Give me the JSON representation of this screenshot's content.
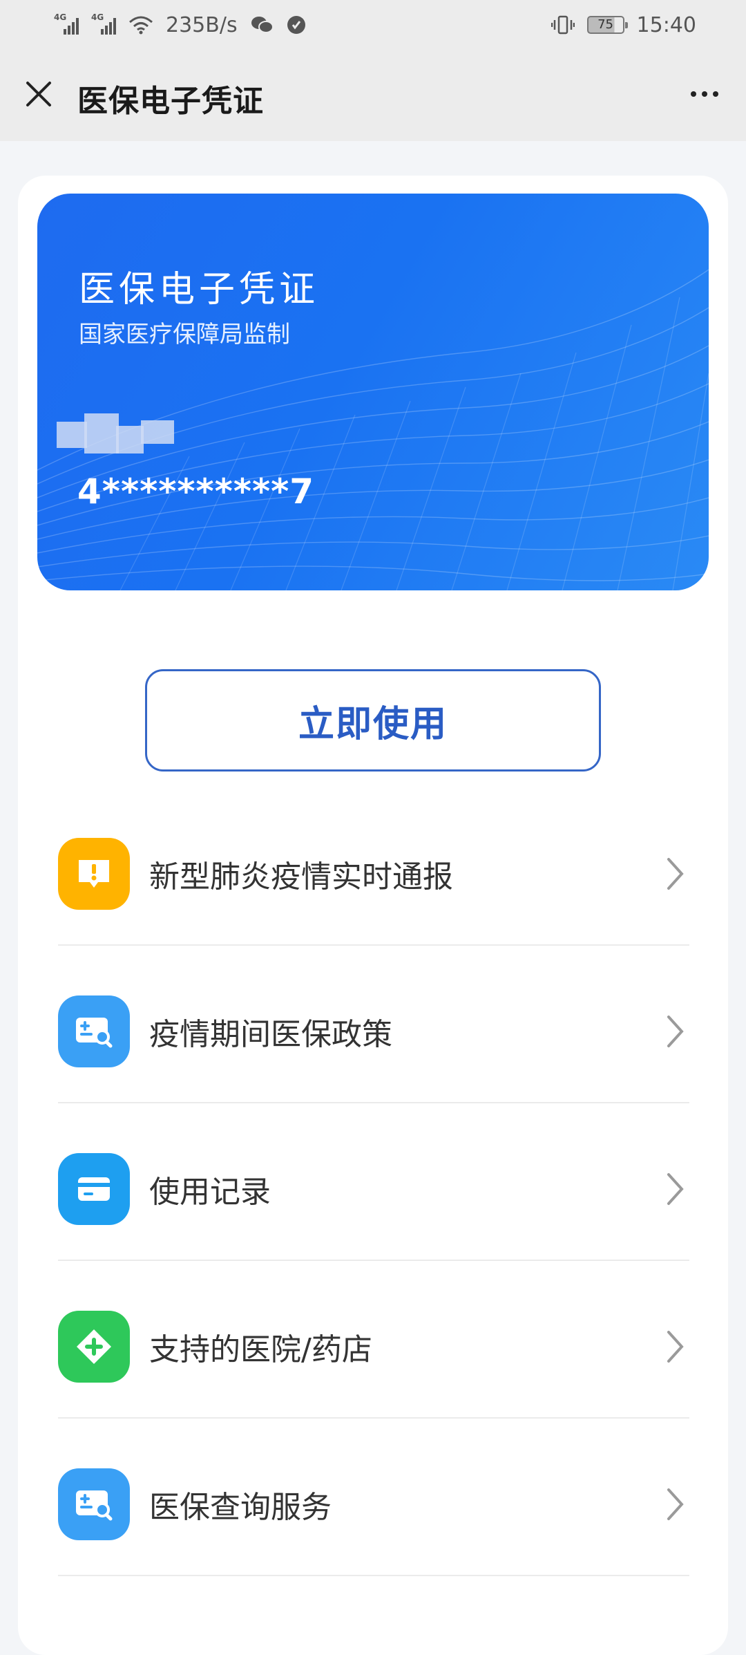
{
  "status_bar": {
    "network_1": "4G",
    "network_2": "4G",
    "speed": "235B/s",
    "battery": "75",
    "time": "15:40"
  },
  "header": {
    "title": "医保电子凭证"
  },
  "card": {
    "title": "医保电子凭证",
    "subtitle": "国家医疗保障局监制",
    "number": "4**********7"
  },
  "use_button": "立即使用",
  "menu": [
    {
      "label": "新型肺炎疫情实时通报",
      "icon": "alert-icon",
      "color": "#ffb300"
    },
    {
      "label": "疫情期间医保政策",
      "icon": "policy-search-icon",
      "color": "#3aa0f5"
    },
    {
      "label": "使用记录",
      "icon": "card-icon",
      "color": "#1e9ff0"
    },
    {
      "label": "支持的医院/药店",
      "icon": "medical-cross-icon",
      "color": "#2ec85a"
    },
    {
      "label": "医保查询服务",
      "icon": "policy-search-icon",
      "color": "#3aa0f5"
    }
  ],
  "colors": {
    "card_blue": "#1e6bf0",
    "button_border": "#3566c7",
    "chevron": "#9a9a9a"
  }
}
